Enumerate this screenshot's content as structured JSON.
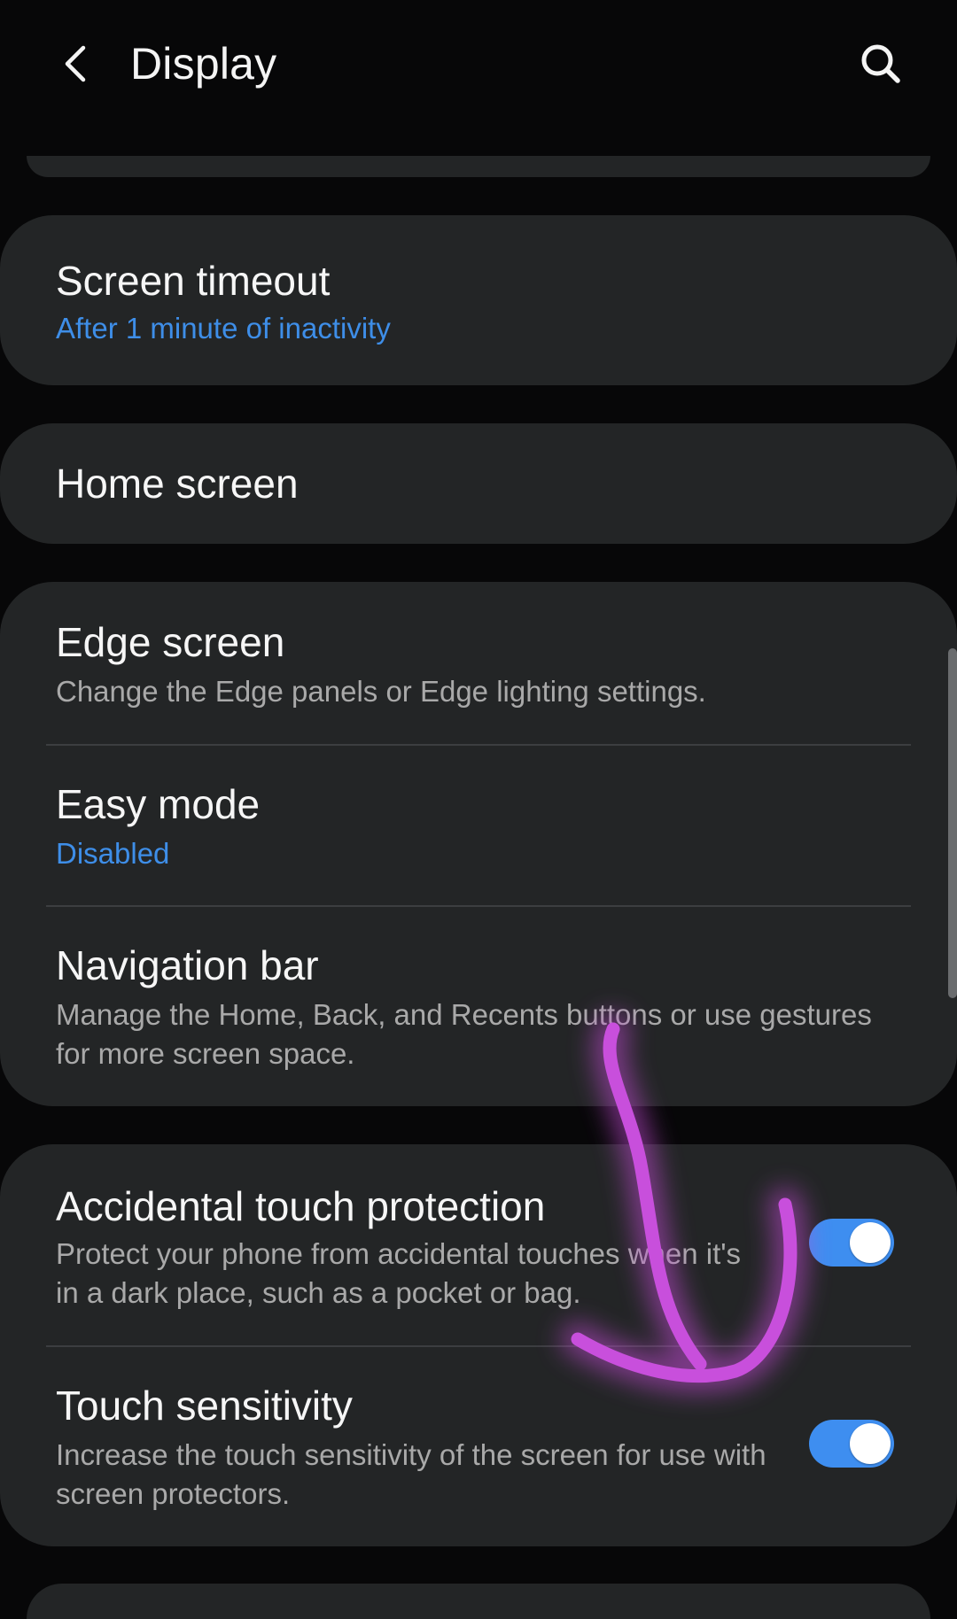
{
  "header": {
    "title": "Display",
    "back_icon": "back-arrow-icon",
    "search_icon": "search-icon"
  },
  "settings": {
    "screen_timeout": {
      "title": "Screen timeout",
      "value": "After 1 minute of inactivity"
    },
    "home_screen": {
      "title": "Home screen"
    },
    "edge_screen": {
      "title": "Edge screen",
      "description": "Change the Edge panels or Edge lighting settings."
    },
    "easy_mode": {
      "title": "Easy mode",
      "value": "Disabled"
    },
    "navigation_bar": {
      "title": "Navigation bar",
      "description_line1": "Manage the Home, Back, and Recents buttons or use gestures",
      "description_line2": "for more screen space."
    },
    "accidental_touch": {
      "title": "Accidental touch protection",
      "description_line1": "Protect your phone from accidental touches when it's",
      "description_line2": "in a dark place, such as a pocket or bag.",
      "enabled": true
    },
    "touch_sensitivity": {
      "title": "Touch sensitivity",
      "description_line1": "Increase the touch sensitivity of the screen for use with",
      "description_line2": "screen protectors.",
      "enabled": true
    }
  },
  "annotation": {
    "shape": "hand-drawn-arrow",
    "color": "#c44bd6"
  },
  "colors": {
    "background": "#070708",
    "card": "#232526",
    "accent": "#3e8ee8",
    "toggle_on": "#3e8ef0",
    "text_primary": "#f6f6f6",
    "text_secondary": "#a9a9a9"
  }
}
